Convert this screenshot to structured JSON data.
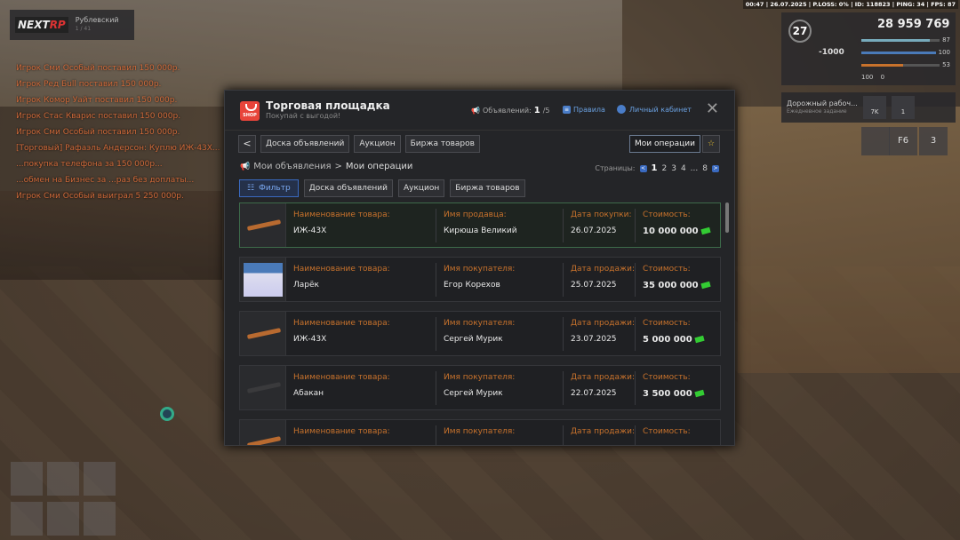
{
  "hud": {
    "status_line": "00:47 | 26.07.2025 | P.LOSS: 0% | ID: 118823 | PING: 34 | FPS: 87",
    "server_logo": "NEXT",
    "server_logo_suffix": "RP",
    "server_name": "Рублевский",
    "server_online": "1 / 41",
    "level": "27",
    "money": "28 959 769",
    "debt": "-1000",
    "health": "87",
    "armor": "100",
    "hunger": "53",
    "stat4": "100",
    "stat5": "0",
    "quest_title": "Дорожный рабоч...",
    "quest_sub": "Ежедневное задание",
    "quest_count1": "7K",
    "quest_count2": "1",
    "quick_label": "F6",
    "notif_count": "3"
  },
  "chat": [
    "Игрок Сми Особый поставил 150 000р.",
    "Игрок Ред Бull поставил 150 000р.",
    "Игрок Комор Уайт поставил 150 000р.",
    "Игрок Стас Кварис поставил 150 000р.",
    "Игрок Сми Особый поставил 150 000р.",
    "[Торговый] Рафаэль Андерсон: Куплю ИЖ-43Х...",
    "...покупка телефона за 150 000р...",
    "...обмен на Бизнес за ...раз без доплаты...",
    "Игрок Сми Особый выиграл 5 250 000р."
  ],
  "panel": {
    "title": "Торговая площадка",
    "subtitle": "Покупай с выгодой!",
    "ads_label": "Объявлений:",
    "ads_count": "1",
    "ads_max": "/5",
    "rules_label": "Правила",
    "cabinet_label": "Личный кабинет",
    "nav": {
      "back": "<",
      "board": "Доска объявлений",
      "auction": "Аукцион",
      "exchange": "Биржа товаров",
      "my_operations": "Мои операции",
      "favorite": "☆"
    },
    "breadcrumb": {
      "parent": "Мои объявления",
      "sep": ">",
      "current": "Мои операции"
    },
    "pager": {
      "label": "Страницы:",
      "pages": [
        "1",
        "2",
        "3",
        "4"
      ],
      "ellipsis": "...",
      "last": "8",
      "prev": "<",
      "next": ">"
    },
    "filters": {
      "filter": "Фильтр",
      "board": "Доска объявлений",
      "auction": "Аукцион",
      "exchange": "Биржа товаров"
    },
    "rows": [
      {
        "item_label": "Наименование товара:",
        "item": "ИЖ-43Х",
        "party_label": "Имя продавца:",
        "party": "Кирюша Великий",
        "date_label": "Дата покупки:",
        "date": "26.07.2025",
        "price_label": "Стоимость:",
        "price": "10 000 000",
        "thumb": "shotgun"
      },
      {
        "item_label": "Наименование товара:",
        "item": "Ларёк",
        "party_label": "Имя покупателя:",
        "party": "Егор Корехов",
        "date_label": "Дата продажи:",
        "date": "25.07.2025",
        "price_label": "Стоимость:",
        "price": "35 000 000",
        "thumb": "kiosk"
      },
      {
        "item_label": "Наименование товара:",
        "item": "ИЖ-43Х",
        "party_label": "Имя покупателя:",
        "party": "Сергей Мурик",
        "date_label": "Дата продажи:",
        "date": "23.07.2025",
        "price_label": "Стоимость:",
        "price": "5 000 000",
        "thumb": "shotgun"
      },
      {
        "item_label": "Наименование товара:",
        "item": "Абакан",
        "party_label": "Имя покупателя:",
        "party": "Сергей Мурик",
        "date_label": "Дата продажи:",
        "date": "22.07.2025",
        "price_label": "Стоимость:",
        "price": "3 500 000",
        "thumb": "rifle"
      },
      {
        "item_label": "Наименование товара:",
        "item": "",
        "party_label": "Имя покупателя:",
        "party": "",
        "date_label": "Дата продажи:",
        "date": "",
        "price_label": "Стоимость:",
        "price": "",
        "thumb": "shotgun"
      }
    ]
  },
  "colors": {
    "accent_orange": "#c8722c",
    "link_blue": "#6aa0e0",
    "shop_red": "#e8443a"
  }
}
